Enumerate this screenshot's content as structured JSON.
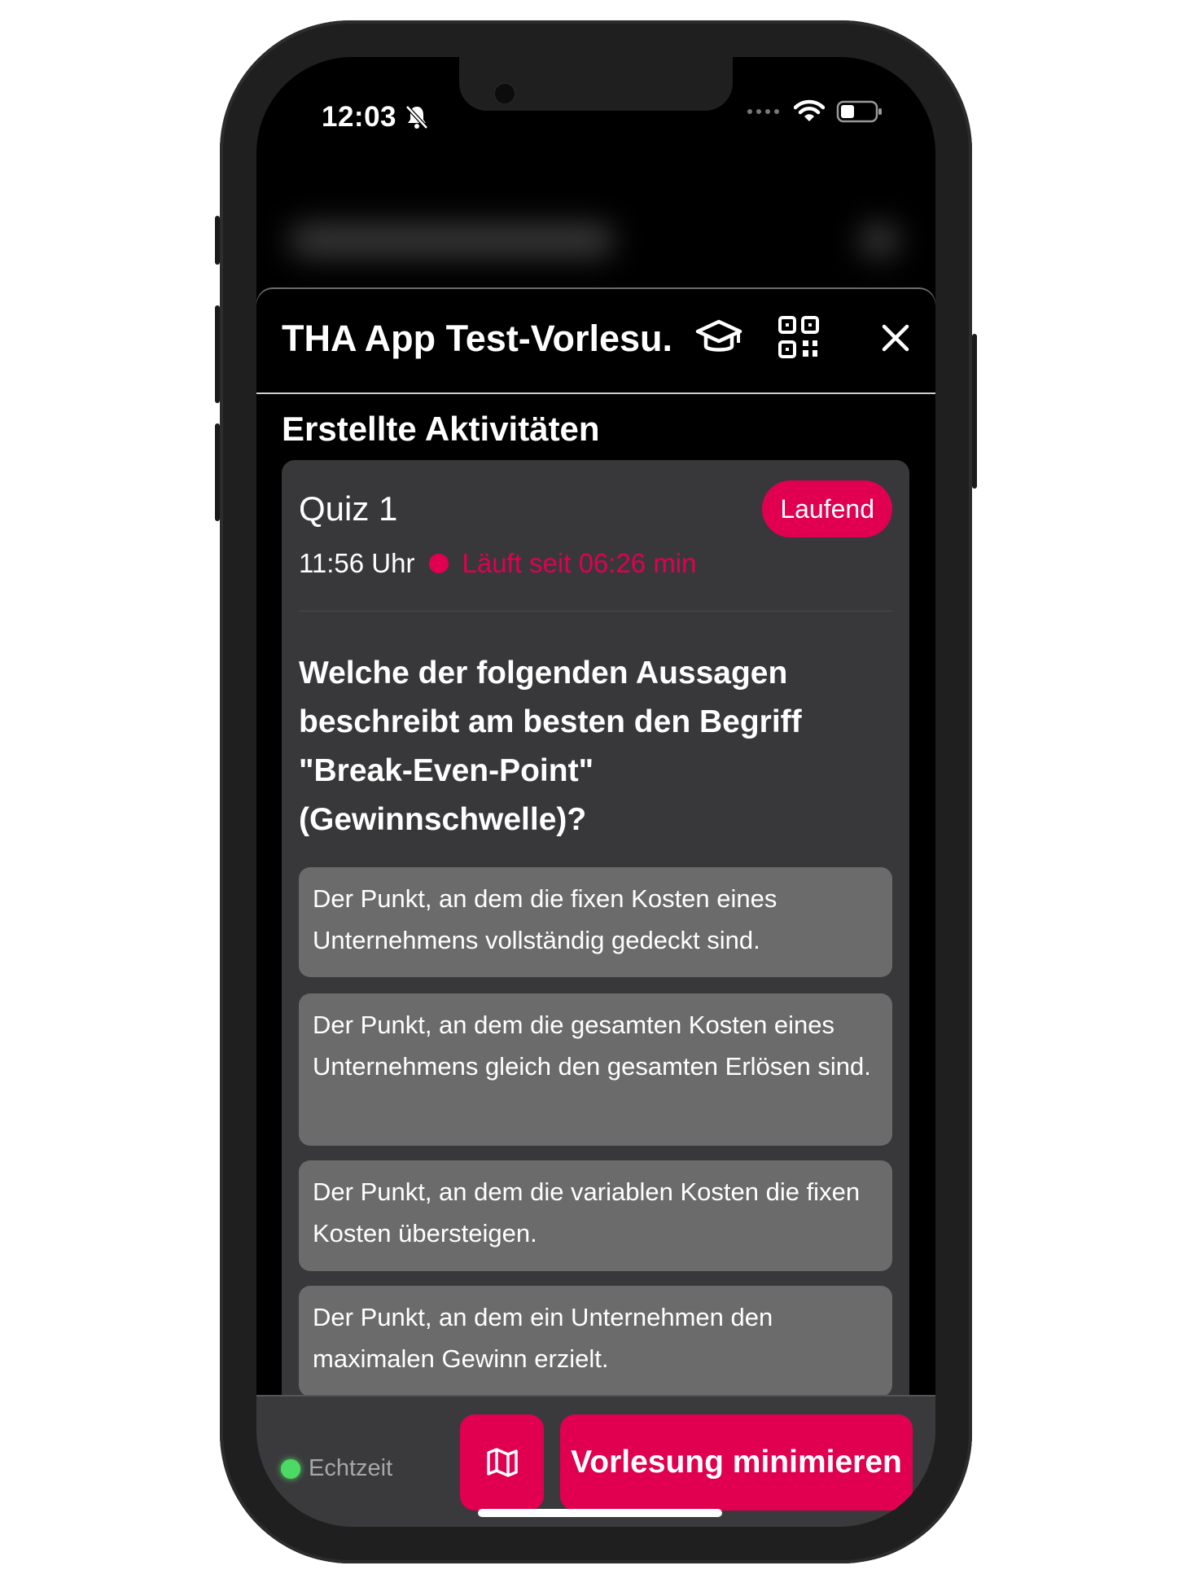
{
  "status_bar": {
    "time": "12:03"
  },
  "header": {
    "title": "THA App Test-Vorlesu..."
  },
  "activities": {
    "section_title": "Erstellte Aktivitäten",
    "quiz": {
      "title": "Quiz 1",
      "status_badge": "Laufend",
      "start_time": "11:56 Uhr",
      "running_text": "Läuft seit 06:26 min",
      "question": "Welche der folgenden Aussagen beschreibt am besten den Begriff \"Break-Even-Point\" (Gewinnschwelle)?",
      "options": [
        "Der Punkt, an dem die fixen Kosten eines Unternehmens vollständig gedeckt sind.",
        "Der Punkt, an dem die gesamten Kosten eines Unternehmens gleich den gesamten Erlösen sind.",
        "Der Punkt, an dem die variablen Kosten die fixen Kosten übersteigen.",
        "Der Punkt, an dem ein Unternehmen den maximalen Gewinn erzielt."
      ]
    }
  },
  "bottom_bar": {
    "live_label": "Echtzeit",
    "minimize_label": "Vorlesung minimieren"
  },
  "colors": {
    "accent": "#e0004f",
    "card": "#38383a",
    "option": "#6b6b6b",
    "live": "#4cd964"
  }
}
